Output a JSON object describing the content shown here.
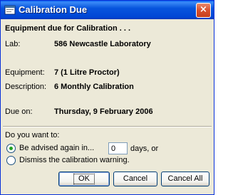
{
  "window": {
    "title": "Calibration Due",
    "close_glyph": "×"
  },
  "heading": "Equipment due for Calibration . . .",
  "fields": {
    "lab_label": "Lab:",
    "lab_value": "586 Newcastle Laboratory",
    "equipment_label": "Equipment:",
    "equipment_value": "7 (1 Litre Proctor)",
    "description_label": "Description:",
    "description_value": "6 Monthly Calibration",
    "due_label": "Due on:",
    "due_value": "Thursday, 9 February 2006"
  },
  "options": {
    "question": "Do you want to:",
    "advise_label": "Be advised again in...",
    "advise_selected": true,
    "days_value": "0",
    "days_suffix": "days, or",
    "dismiss_label": "Dismiss the calibration warning.",
    "dismiss_selected": false
  },
  "buttons": {
    "ok": "OK",
    "cancel": "Cancel",
    "cancel_all": "Cancel All"
  },
  "colors": {
    "titlebar": "#0855dd",
    "dialog_bg": "#ece9d8",
    "radio_dot": "#21a121",
    "close_button": "#d9502e"
  }
}
